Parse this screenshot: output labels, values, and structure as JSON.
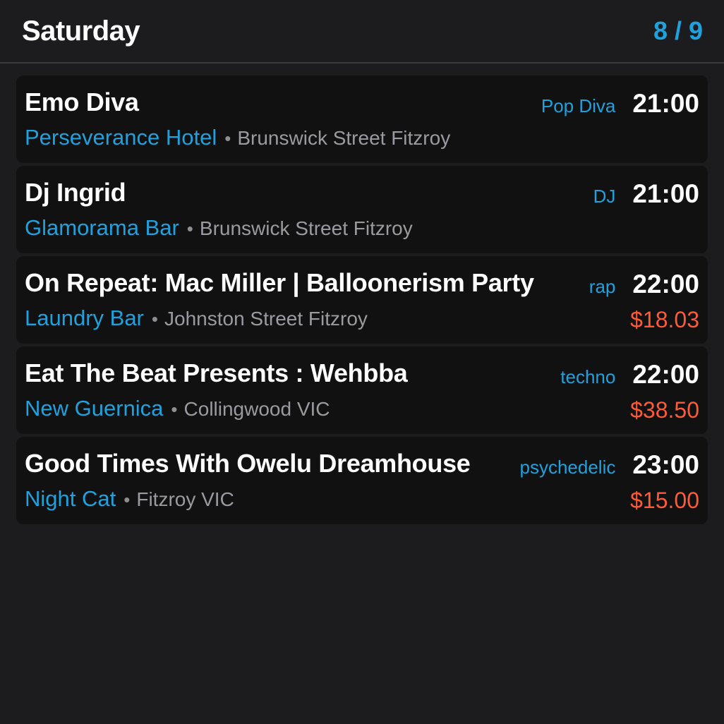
{
  "header": {
    "day": "Saturday",
    "page_counter": "8 / 9"
  },
  "colors": {
    "accent": "#1ea1dc",
    "price": "#ff5a36",
    "background": "#1c1c1e",
    "card": "#111112"
  },
  "events": [
    {
      "title": "Emo Diva",
      "genre": "Pop Diva",
      "time": "21:00",
      "venue": "Perseverance Hotel",
      "separator": "•",
      "address": "Brunswick Street Fitzroy",
      "price": ""
    },
    {
      "title": "Dj Ingrid",
      "genre": "DJ",
      "time": "21:00",
      "venue": "Glamorama Bar",
      "separator": "•",
      "address": "Brunswick Street Fitzroy",
      "price": ""
    },
    {
      "title": "On Repeat: Mac Miller | Balloonerism Party",
      "genre": "rap",
      "time": "22:00",
      "venue": "Laundry Bar",
      "separator": "•",
      "address": "Johnston Street Fitzroy",
      "price": "$18.03"
    },
    {
      "title": "Eat The Beat Presents : Wehbba",
      "genre": "techno",
      "time": "22:00",
      "venue": "New Guernica",
      "separator": "•",
      "address": "Collingwood VIC",
      "price": "$38.50"
    },
    {
      "title": "Good Times With Owelu Dreamhouse",
      "genre": "psychedelic",
      "time": "23:00",
      "venue": "Night Cat",
      "separator": "•",
      "address": "Fitzroy VIC",
      "price": "$15.00"
    }
  ]
}
